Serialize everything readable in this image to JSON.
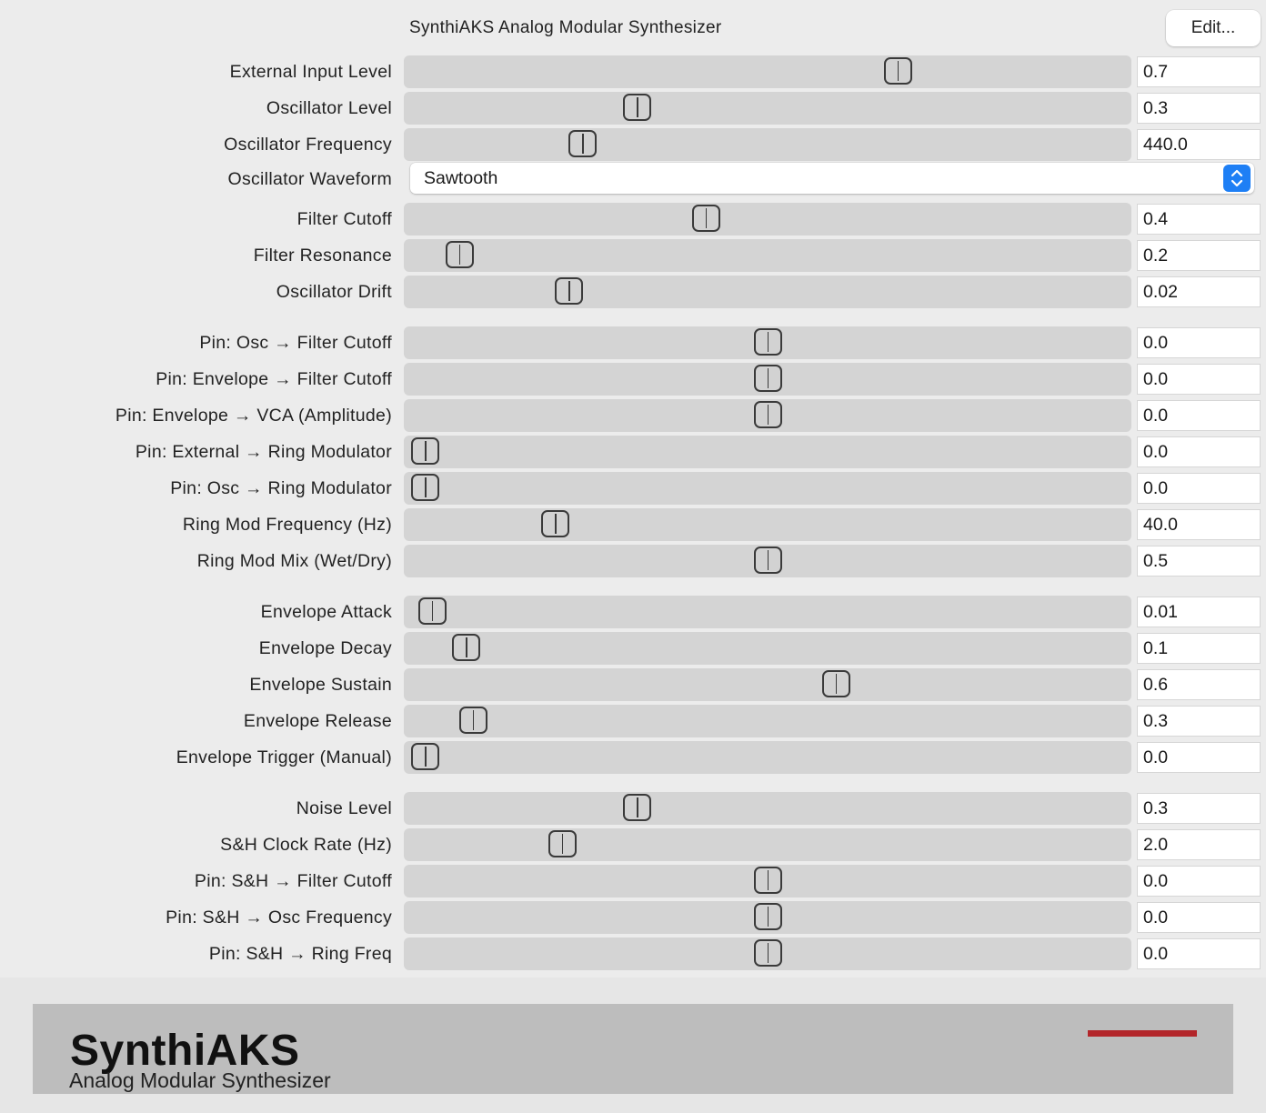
{
  "header": {
    "title": "SynthiAKS Analog Modular Synthesizer",
    "edit_label": "Edit..."
  },
  "params": [
    {
      "label": "External Input Level",
      "value": "0.7",
      "level": 0.69
    },
    {
      "label": "Oscillator Level",
      "value": "0.3",
      "level": 0.31
    },
    {
      "label": "Oscillator Frequency",
      "value": "440.0",
      "level": 0.23
    },
    {
      "label": "Filter Cutoff",
      "value": "0.4",
      "level": 0.41
    },
    {
      "label": "Filter Resonance",
      "value": "0.2",
      "level": 0.05
    },
    {
      "label": "Oscillator Drift",
      "value": "0.02",
      "level": 0.21
    },
    {
      "label": "Pin: Osc → Filter Cutoff",
      "value": "0.0",
      "level": 0.5
    },
    {
      "label": "Pin: Envelope → Filter Cutoff",
      "value": "0.0",
      "level": 0.5
    },
    {
      "label": "Pin: Envelope → VCA (Amplitude)",
      "value": "0.0",
      "level": 0.5
    },
    {
      "label": "Pin: External → Ring Modulator",
      "value": "0.0",
      "level": 0.0
    },
    {
      "label": "Pin: Osc → Ring Modulator",
      "value": "0.0",
      "level": 0.0
    },
    {
      "label": "Ring Mod Frequency (Hz)",
      "value": "40.0",
      "level": 0.19
    },
    {
      "label": "Ring Mod Mix (Wet/Dry)",
      "value": "0.5",
      "level": 0.5
    },
    {
      "label": "Envelope Attack",
      "value": "0.01",
      "level": 0.01
    },
    {
      "label": "Envelope Decay",
      "value": "0.1",
      "level": 0.06
    },
    {
      "label": "Envelope Sustain",
      "value": "0.6",
      "level": 0.6
    },
    {
      "label": "Envelope Release",
      "value": "0.3",
      "level": 0.07
    },
    {
      "label": "Envelope Trigger (Manual)",
      "value": "0.0",
      "level": 0.0
    },
    {
      "label": "Noise Level",
      "value": "0.3",
      "level": 0.31
    },
    {
      "label": "S&H Clock Rate (Hz)",
      "value": "2.0",
      "level": 0.2
    },
    {
      "label": "Pin: S&H → Filter Cutoff",
      "value": "0.0",
      "level": 0.5
    },
    {
      "label": "Pin: S&H → Osc Frequency",
      "value": "0.0",
      "level": 0.5
    },
    {
      "label": "Pin: S&H → Ring Freq",
      "value": "0.0",
      "level": 0.5
    }
  ],
  "waveform": {
    "label": "Oscillator Waveform",
    "value": "Sawtooth"
  },
  "footer": {
    "logo": "SynthiAKS",
    "subtitle": "Analog Modular Synthesizer"
  },
  "colors": {
    "accent": "#1e7ff5",
    "brand_red": "#b3262a"
  },
  "icons": {
    "select_arrows": "chevron-up-down-icon"
  }
}
